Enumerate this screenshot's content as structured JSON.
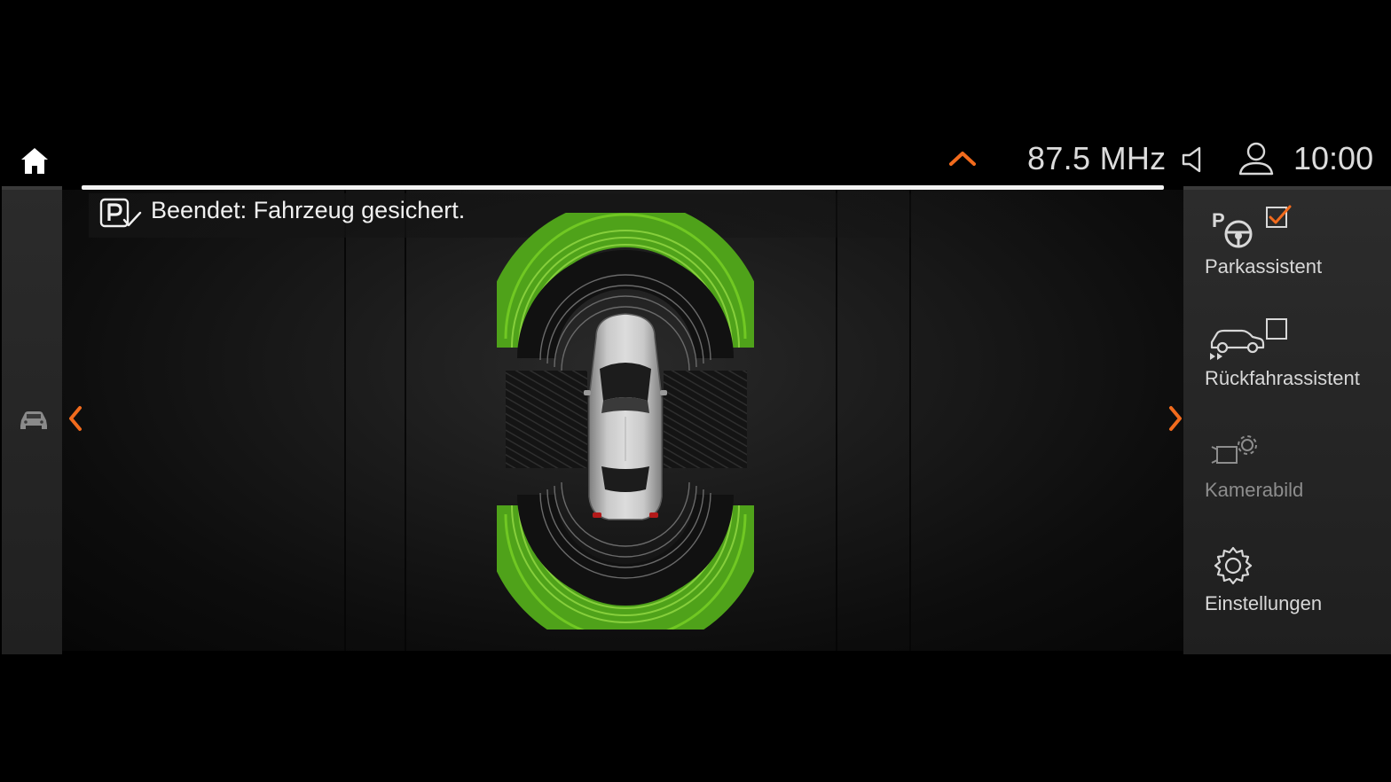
{
  "statusbar": {
    "home_icon": "home-icon",
    "radio_frequency": "87.5 MHz",
    "clock": "10:00",
    "speaker_icon": "speaker-icon",
    "profile_icon": "profile-icon",
    "expand_icon": "chevron-up-icon"
  },
  "notice": {
    "icon": "parking-check-icon",
    "text": "Beendet: Fahrzeug gesichert."
  },
  "left_rail": {
    "icon": "car-icon"
  },
  "right_panel": {
    "items": [
      {
        "label": "Parkassistent",
        "icon": "park-steering-icon",
        "checked": true
      },
      {
        "label": "Rückfahrassistent",
        "icon": "reverse-assist-icon",
        "checked": false
      },
      {
        "label": "Kamerabild",
        "icon": "camera-settings-icon",
        "enabled": false
      },
      {
        "label": "Einstellungen",
        "icon": "gear-icon"
      }
    ]
  },
  "colors": {
    "accent_orange": "#f26b1d",
    "sensor_green": "#6fcf1f",
    "sensor_yellow": "#e2b300",
    "background": "#000000"
  }
}
